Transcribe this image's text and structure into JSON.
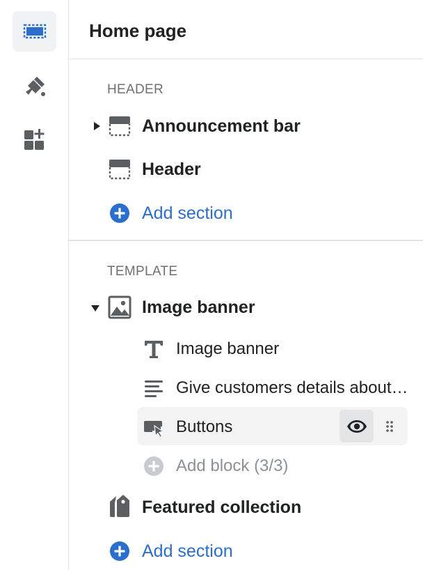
{
  "panel": {
    "title": "Home page"
  },
  "header_group": {
    "label": "HEADER",
    "sections": [
      {
        "label": "Announcement bar",
        "icon": "section-header-icon",
        "expandable": true
      },
      {
        "label": "Header",
        "icon": "section-header-icon",
        "expandable": false
      }
    ],
    "add_section_label": "Add section"
  },
  "template_group": {
    "label": "TEMPLATE",
    "image_banner": {
      "label": "Image banner",
      "icon": "image-icon",
      "expanded": true,
      "blocks": [
        {
          "label": "Image banner",
          "icon": "text-heading-icon"
        },
        {
          "label": "Give customers details about…",
          "icon": "text-lines-icon"
        },
        {
          "label": "Buttons",
          "icon": "button-cursor-icon"
        }
      ],
      "add_block_label": "Add block (3/3)"
    },
    "featured_collection": {
      "label": "Featured collection",
      "icon": "tags-icon"
    },
    "add_section_label": "Add section"
  },
  "colors": {
    "accent": "#2c6ecb",
    "icon": "#5c5f62",
    "muted": "#8c9196",
    "rail_active_bg": "#f1f2f4"
  }
}
